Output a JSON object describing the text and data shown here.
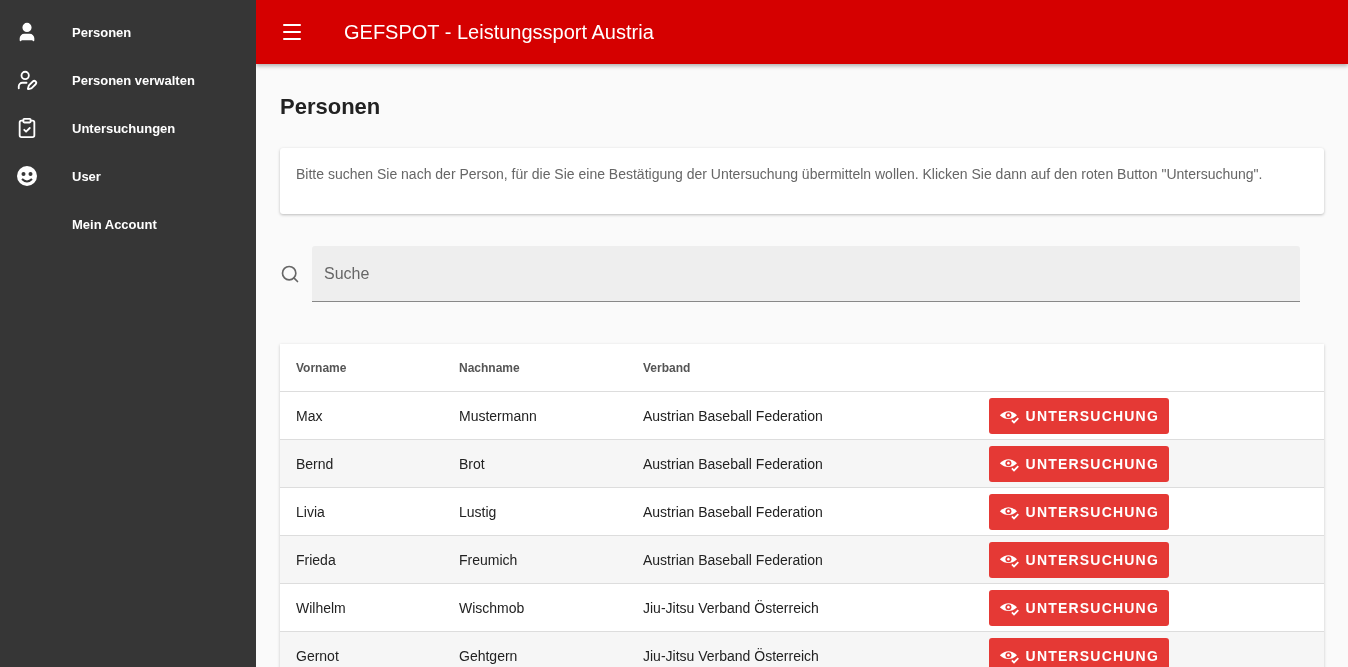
{
  "sidebar": {
    "items": [
      {
        "label": "Personen",
        "kind": "person"
      },
      {
        "label": "Personen verwalten",
        "kind": "person_edit"
      },
      {
        "label": "Untersuchungen",
        "kind": "clipboard"
      },
      {
        "label": "User",
        "kind": "face"
      },
      {
        "label": "Mein Account",
        "kind": "text"
      }
    ]
  },
  "app_bar": {
    "title": "GEFSPOT - Leistungssport Austria"
  },
  "page": {
    "title": "Personen",
    "info": "Bitte suchen Sie nach der Person, für die Sie eine Bestätigung der Untersuchung übermitteln wollen. Klicken Sie dann auf den roten Button \"Untersuchung\"."
  },
  "search": {
    "placeholder": "Suche"
  },
  "table": {
    "columns": [
      "Vorname",
      "Nachname",
      "Verband"
    ],
    "rows": [
      {
        "cells": [
          "Max",
          "Mustermann",
          "Austrian Baseball Federation"
        ],
        "action": "UNTERSUCHUNG"
      },
      {
        "cells": [
          "Bernd",
          "Brot",
          "Austrian Baseball Federation"
        ],
        "action": "UNTERSUCHUNG"
      },
      {
        "cells": [
          "Livia",
          "Lustig",
          "Austrian Baseball Federation"
        ],
        "action": "UNTERSUCHUNG"
      },
      {
        "cells": [
          "Frieda",
          "Freumich",
          "Austrian Baseball Federation"
        ],
        "action": "UNTERSUCHUNG"
      },
      {
        "cells": [
          "Wilhelm",
          "Wischmob",
          "Jiu-Jitsu Verband Österreich"
        ],
        "action": "UNTERSUCHUNG"
      },
      {
        "cells": [
          "Gernot",
          "Gehtgern",
          "Jiu-Jitsu Verband Österreich"
        ],
        "action": "UNTERSUCHUNG"
      }
    ]
  }
}
